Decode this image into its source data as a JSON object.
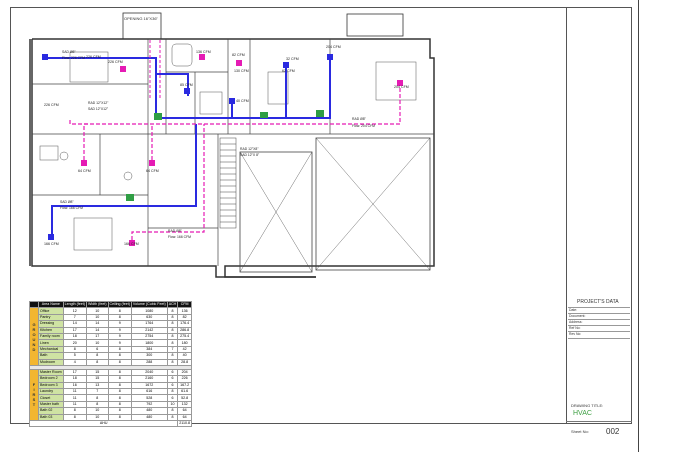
{
  "plan": {
    "opening_label": "OPENING 16\"X36\"",
    "cfm_labels": {
      "c1": "226 CFM",
      "c2": "226 CFM",
      "c3": "136 CFM",
      "c4": "85 CFM",
      "c5": "82 CFM",
      "c6": "130 CFM",
      "c7": "62 CFM",
      "c8": "204 CFM",
      "c9": "204 CFM",
      "c10": "64 CFM",
      "c11": "64 CFM",
      "c12": "166 CFM",
      "c13": "166 CFM",
      "c14": "32 CFM",
      "c15": "40 CFM",
      "c16": "226 CFM"
    },
    "duct_labels": {
      "d1": "RAD 12\"X12\"",
      "d2": "SAD 12\"X12\"",
      "d3": "RAD 12\"X8\"",
      "d4": "SAD 12\"X 8\"",
      "d5": "SAD Ø8\"",
      "d6": "Flow: 226 CFM",
      "d7": "SAD Ø8\"",
      "d8": "Flow: 166 CFM",
      "d9": "RAD Ø8\"",
      "d10": "Flow: 204 CFM",
      "d11": "RAD Ø8\"",
      "d12": "Flow: 166 CFM"
    }
  },
  "schedule": {
    "headers": [
      "",
      "Area Name",
      "Length (feet)",
      "Width (feet)",
      "Ceiling (feet)",
      "Volume (Cubic Feet)",
      "ACH",
      "CFM"
    ],
    "ground_label": "GROUND",
    "first_label": "FIRST",
    "ground_rows": [
      [
        "Office",
        "12",
        "10",
        "8",
        "1080",
        "8",
        "136"
      ],
      [
        "Pantry",
        "7",
        "10",
        "8",
        "630",
        "8",
        "82"
      ],
      [
        "Dressing",
        "14",
        "14",
        "9",
        "1764",
        "8",
        "176.4"
      ],
      [
        "Kitchen",
        "17",
        "14",
        "9",
        "2142",
        "8",
        "286.8"
      ],
      [
        "Family room",
        "18",
        "17",
        "9",
        "2754",
        "8",
        "275.4"
      ],
      [
        "Linen",
        "20",
        "10",
        "9",
        "1800",
        "8",
        "180"
      ],
      [
        "Mechanical",
        "8",
        "6",
        "8",
        "384",
        "7",
        "42"
      ],
      [
        "Bath",
        "5",
        "8",
        "8",
        "300",
        "8",
        "40"
      ],
      [
        "Mudroom",
        "4",
        "8",
        "8",
        "288",
        "8",
        "28.8"
      ]
    ],
    "first_rows": [
      [
        "Master Room",
        "17",
        "15",
        "8",
        "2040",
        "6",
        "204"
      ],
      [
        "Bedroom 2",
        "18",
        "15",
        "8",
        "2160",
        "6",
        "226"
      ],
      [
        "Bedroom 3",
        "16",
        "13",
        "8",
        "1672",
        "6",
        "167.2"
      ],
      [
        "Laundry",
        "11",
        "7",
        "8",
        "616",
        "8",
        "61.6"
      ],
      [
        "Closet",
        "11",
        "8",
        "8",
        "528",
        "6",
        "52.8"
      ],
      [
        "Master bath",
        "11",
        "8",
        "8",
        "792",
        "10",
        "132"
      ],
      [
        "Bath 02",
        "8",
        "10",
        "8",
        "480",
        "8",
        "64"
      ],
      [
        "Bath 03",
        "8",
        "10",
        "8",
        "480",
        "8",
        "64"
      ]
    ],
    "total_label": "AHU",
    "total_value": "2110.8"
  },
  "title_block": {
    "project_data": "PROJECT'S DATA",
    "rows": [
      "Date:",
      "Document:",
      "Address:",
      "Ref No:",
      "Rev No:"
    ],
    "drawing_title_label": "DRAWING TITLE:",
    "drawing_title": "HVAC",
    "sheet_label": "Sheet No:",
    "sheet_no": "002"
  },
  "colors": {
    "supply_duct": "#2a2ae0",
    "return_duct": "#e51bb4",
    "ahu": "#2f9e44",
    "wall": "#333333",
    "floor_label": "#f2b630",
    "room_cell": "#cfe3a3",
    "title_green": "#3ea043"
  }
}
